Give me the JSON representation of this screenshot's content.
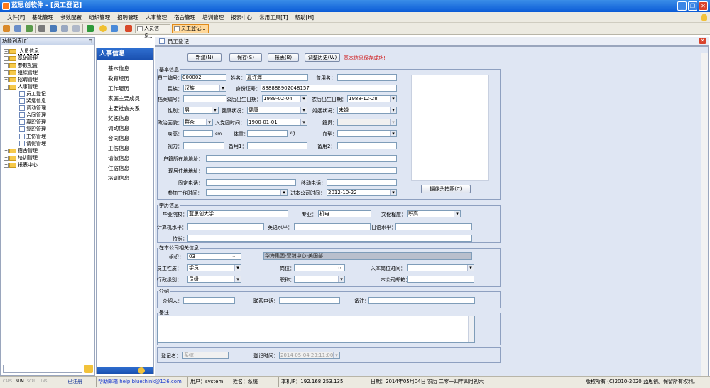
{
  "app": {
    "title": "蓝思创软件 - [员工登记]",
    "window_buttons": [
      "_",
      "❐",
      "✕"
    ]
  },
  "menu": [
    "文件[F]",
    "基础管理",
    "参数配置",
    "组织管理",
    "招聘管理",
    "人事管理",
    "宿舍管理",
    "培训管理",
    "报表中心",
    "常用工具[T]",
    "帮助[H]"
  ],
  "toolbar": {
    "tabs": [
      "人员信息...",
      "员工登记..."
    ]
  },
  "left_panel": {
    "title": "功能列表[F]",
    "root": "人员信息",
    "items": [
      "基础管理",
      "参数配置",
      "组织管理",
      "招聘管理",
      "人事管理",
      "员工登记",
      "奖惩信息",
      "调动管理",
      "合同管理",
      "离职管理",
      "复职管理",
      "工伤管理",
      "请假管理",
      "宿舍管理",
      "培训管理",
      "报表中心"
    ]
  },
  "side_menu": {
    "title": "人事信息",
    "items": [
      "基本信息",
      "教育经历",
      "工作履历",
      "家庭主要成员",
      "主要社会关系",
      "奖惩信息",
      "调动信息",
      "合同信息",
      "工伤信息",
      "请假信息",
      "住宿信息",
      "培训信息"
    ]
  },
  "subtab": "员工登记",
  "actions": {
    "new": "新建(N)",
    "save": "保存(S)",
    "report": "报表(B)",
    "history": "调整历史(W)",
    "message": "基本信息保存成功!"
  },
  "basic": {
    "legend": "基本信息",
    "emp_no_label": "员工编号：",
    "emp_no": "000002",
    "name_label": "姓名：",
    "name": "夏许海",
    "used_name_label": "曾用名：",
    "used_name": "",
    "ethnic_label": "民族：",
    "ethnic": "汉族",
    "id_label": "身份证号：",
    "id_no": "888888902048157",
    "file_no_label": "档案编号：",
    "file_no": "",
    "birth_label": "公历出生日期：",
    "birth": "1989-02-04",
    "lunar_label": "农历出生日期：",
    "lunar": "1988-12-28",
    "gender_label": "性别：",
    "gender": "男",
    "health_label": "健康状况：",
    "health": "健康",
    "marital_label": "婚姻状况：",
    "marital": "未婚",
    "political_label": "政治面貌：",
    "political": "群众",
    "party_label": "入党团时间：",
    "party": "1900-01-01",
    "native_label": "籍贯：",
    "native": "",
    "height_label": "身高：",
    "height_unit": "cm",
    "weight_label": "体重：",
    "weight_unit": "kg",
    "blood_label": "血型：",
    "vision_label": "视力：",
    "memo1_label": "备用1：",
    "memo2_label": "备用2：",
    "hukou_label": "户籍所在地地址：",
    "current_label": "现居住地地址：",
    "phone_label": "固定电话：",
    "mobile_label": "移动电话：",
    "work_start_label": "参加工作时间：",
    "join_label": "进本公司时间：",
    "join": "2012-10-22",
    "camera": "摄像头拍照(C)"
  },
  "edu": {
    "legend": "学历信息",
    "school_label": "毕业院校：",
    "school": "蓝思创大学",
    "major_label": "专业：",
    "major": "机电",
    "level_label": "文化程度：",
    "level": "职高",
    "computer_label": "计算机水平：",
    "english_label": "英语水平：",
    "japanese_label": "日语水平：",
    "skill_label": "特长："
  },
  "company": {
    "legend": "在本公司相关信息",
    "org_label": "组织：",
    "org": "03",
    "org_name": "华海集团-营销中心-美国部",
    "type_label": "员工性质：",
    "type": "学员",
    "post_label": "岗位：",
    "post_time_label": "入本岗位时间：",
    "rank_label": "行政级别：",
    "rank": "员级",
    "title_label": "职称：",
    "email_label": "本公司邮箱："
  },
  "intro": {
    "legend": "介绍",
    "introducer_label": "介绍人：",
    "contact_label": "联系电话：",
    "remark_label": "备注："
  },
  "notes": {
    "legend": "备注"
  },
  "register": {
    "by_label": "登记者：",
    "by": "系统",
    "time_label": "登记时间：",
    "time": "2014-05-04 23:11:00"
  },
  "status": {
    "modes": [
      "CAPS",
      "NUM",
      "SCRL",
      "INS"
    ],
    "registered": "已注册",
    "help": "帮助邮箱 help bluethink@126.com",
    "user": "用户：system",
    "uname": "姓名：系统",
    "ip": "本机IP：192.168.253.135",
    "date": "日期：2014年05月04日  农历 二零一四年四月初六",
    "rights": "版权所有 (C)2010-2020  蓝思创。保留所有权利。"
  }
}
